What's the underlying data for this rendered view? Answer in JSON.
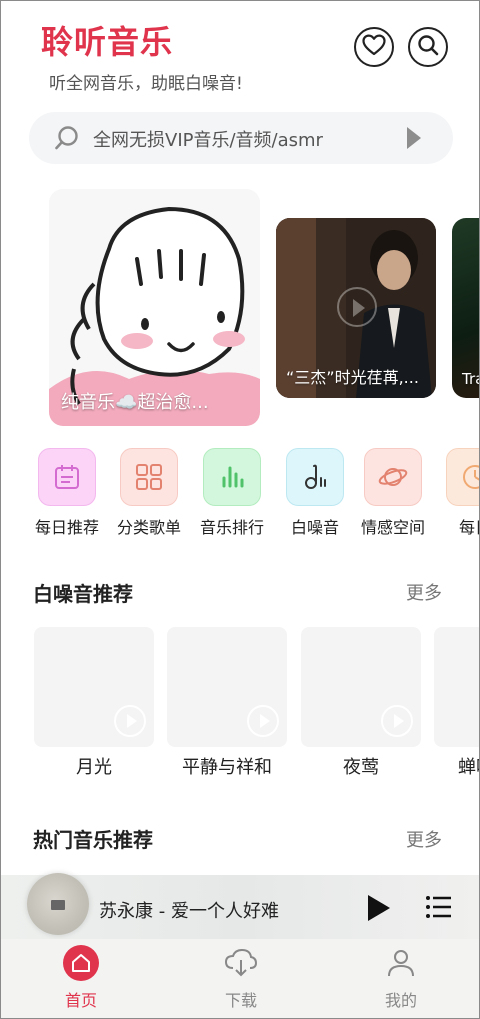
{
  "header": {
    "title": "聆听音乐",
    "subtitle": "听全网音乐，助眠白噪音!",
    "favorite_icon": "heart-icon",
    "search_icon": "search-icon",
    "accent_color": "#e0344d"
  },
  "search": {
    "placeholder": "全网无损VIP音乐/音频/asmr"
  },
  "banners": [
    {
      "caption": "纯音乐☁️超治愈..."
    },
    {
      "caption": "“三杰”时光荏苒,..."
    },
    {
      "caption": "Tra"
    }
  ],
  "categories": [
    {
      "label": "每日推荐",
      "icon": "calendar-icon",
      "color": "#f7c9f3"
    },
    {
      "label": "分类歌单",
      "icon": "grid-icon",
      "color": "#fde0dc"
    },
    {
      "label": "音乐排行",
      "icon": "bar-chart-icon",
      "color": "#cff5d8"
    },
    {
      "label": "白噪音",
      "icon": "music-note-icon",
      "color": "#d9f5fa"
    },
    {
      "label": "情感空间",
      "icon": "planet-icon",
      "color": "#fde0dc"
    },
    {
      "label": "每日",
      "icon": "clock-icon",
      "color": "#fde8d8"
    }
  ],
  "white_noise": {
    "title": "白噪音推荐",
    "more": "更多",
    "items": [
      {
        "name": "月光"
      },
      {
        "name": "平静与祥和"
      },
      {
        "name": "夜莺"
      },
      {
        "name": "蝉鸣"
      }
    ]
  },
  "hot_music": {
    "title": "热门音乐推荐",
    "more": "更多"
  },
  "player": {
    "song": "苏永康 - 爱一个人好难",
    "play_icon": "play-icon",
    "playlist_icon": "playlist-icon"
  },
  "nav": [
    {
      "label": "首页",
      "icon": "home-icon",
      "active": true
    },
    {
      "label": "下载",
      "icon": "cloud-download-icon",
      "active": false
    },
    {
      "label": "我的",
      "icon": "user-icon",
      "active": false
    }
  ]
}
